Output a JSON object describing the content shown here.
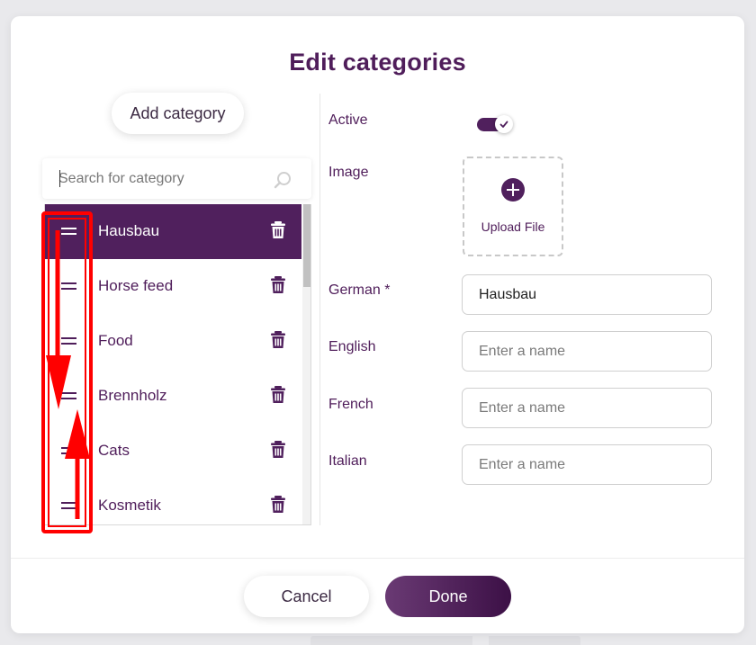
{
  "dialog": {
    "title": "Edit categories",
    "add_button_label": "Add category",
    "search": {
      "placeholder": "Search for category"
    },
    "categories": [
      {
        "label": "Hausbau",
        "selected": true
      },
      {
        "label": "Horse feed",
        "selected": false
      },
      {
        "label": "Food",
        "selected": false
      },
      {
        "label": "Brennholz",
        "selected": false
      },
      {
        "label": "Cats",
        "selected": false
      },
      {
        "label": "Kosmetik",
        "selected": false
      }
    ],
    "form": {
      "active_label": "Active",
      "active_value": true,
      "image_label": "Image",
      "upload_label": "Upload File",
      "fields": [
        {
          "label": "German *",
          "value": "Hausbau",
          "placeholder": ""
        },
        {
          "label": "English",
          "value": "",
          "placeholder": "Enter a name"
        },
        {
          "label": "French",
          "value": "",
          "placeholder": "Enter a name"
        },
        {
          "label": "Italian",
          "value": "",
          "placeholder": "Enter a name"
        }
      ]
    },
    "footer": {
      "cancel_label": "Cancel",
      "done_label": "Done"
    }
  },
  "colors": {
    "accent": "#50205d",
    "annotation": "#ff0000"
  },
  "icons": [
    "search-icon",
    "drag-handle-icon",
    "trash-icon",
    "toggle-check-icon",
    "plus-circle-icon"
  ]
}
